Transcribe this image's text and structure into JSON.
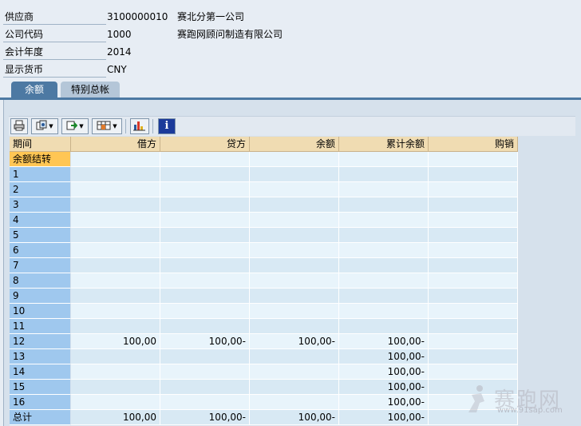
{
  "header": {
    "fields": [
      {
        "label": "供应商",
        "value": "3100000010",
        "desc": "赛北分第一公司"
      },
      {
        "label": "公司代码",
        "value": "1000",
        "desc": "赛跑网顾问制造有限公司"
      },
      {
        "label": "会计年度",
        "value": "2014",
        "desc": ""
      },
      {
        "label": "显示货币",
        "value": "CNY",
        "desc": ""
      }
    ]
  },
  "tabs": [
    {
      "label": "余额",
      "active": true
    },
    {
      "label": "特别总帐",
      "active": false
    }
  ],
  "toolbar": {
    "buttons": [
      "print-icon",
      "filter-icon",
      "export-icon",
      "layout-icon",
      "chart-icon",
      "info-icon"
    ]
  },
  "table": {
    "columns": [
      "期间",
      "借方",
      "贷方",
      "余额",
      "累计余额",
      "购销"
    ],
    "rows": [
      [
        "余额结转",
        "",
        "",
        "",
        "",
        ""
      ],
      [
        "1",
        "",
        "",
        "",
        "",
        ""
      ],
      [
        "2",
        "",
        "",
        "",
        "",
        ""
      ],
      [
        "3",
        "",
        "",
        "",
        "",
        ""
      ],
      [
        "4",
        "",
        "",
        "",
        "",
        ""
      ],
      [
        "5",
        "",
        "",
        "",
        "",
        ""
      ],
      [
        "6",
        "",
        "",
        "",
        "",
        ""
      ],
      [
        "7",
        "",
        "",
        "",
        "",
        ""
      ],
      [
        "8",
        "",
        "",
        "",
        "",
        ""
      ],
      [
        "9",
        "",
        "",
        "",
        "",
        ""
      ],
      [
        "10",
        "",
        "",
        "",
        "",
        ""
      ],
      [
        "11",
        "",
        "",
        "",
        "",
        ""
      ],
      [
        "12",
        "100,00",
        "100,00-",
        "100,00-",
        "100,00-",
        ""
      ],
      [
        "13",
        "",
        "",
        "",
        "100,00-",
        ""
      ],
      [
        "14",
        "",
        "",
        "",
        "100,00-",
        ""
      ],
      [
        "15",
        "",
        "",
        "",
        "100,00-",
        ""
      ],
      [
        "16",
        "",
        "",
        "",
        "100,00-",
        ""
      ],
      [
        "总计",
        "100,00",
        "100,00-",
        "100,00-",
        "100,00-",
        ""
      ]
    ],
    "selected_row": 0
  },
  "watermark": {
    "text": "赛跑网",
    "url": "www.91sap.com"
  },
  "colors": {
    "accent": "#4d79a3",
    "header_cell": "#f0dcb2",
    "period_cell": "#9fc8ee",
    "selected": "#ffc654"
  }
}
